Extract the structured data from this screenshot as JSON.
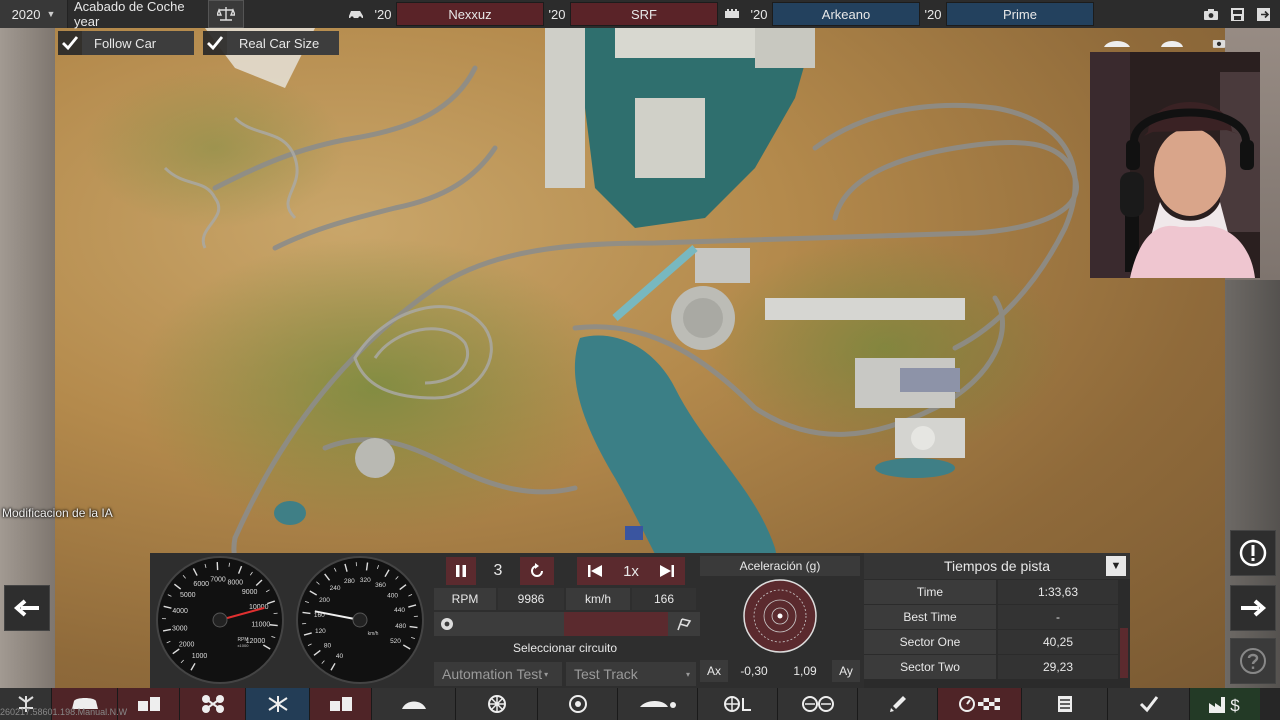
{
  "topbar": {
    "year": "2020",
    "finish_label": "Acabado de Coche year",
    "rival1_year": "'20",
    "rival1": "Nexxuz",
    "rival2_year": "'20",
    "rival2": "SRF",
    "rival3_year": "'20",
    "rival3": "Arkeano",
    "rival4_year": "'20",
    "rival4": "Prime"
  },
  "options": {
    "follow_car": "Follow Car",
    "real_car_size": "Real Car Size"
  },
  "ai_mod_label": "Modificacion de la IA",
  "gauges": {
    "rpm_ticks": [
      "1000",
      "2000",
      "3000",
      "4000",
      "5000",
      "6000",
      "7000",
      "8000",
      "9000",
      "10000",
      "11000",
      "12000"
    ],
    "rpm_unit": "RPM\nx1000",
    "speed_ticks": [
      "40",
      "80",
      "120",
      "160",
      "200",
      "240",
      "280",
      "320",
      "360",
      "400",
      "440",
      "480",
      "520"
    ],
    "speed_unit": "km/h"
  },
  "playback": {
    "lap": "3",
    "speed": "1x"
  },
  "readout": {
    "rpm_label": "RPM",
    "rpm_value": "9986",
    "speed_label": "km/h",
    "speed_value": "166",
    "select_circuit": "Seleccionar circuito",
    "track_group": "Automation Test",
    "track_name": "Test Track"
  },
  "accel": {
    "title": "Aceleración (g)",
    "ax_label": "Ax",
    "ax_value": "-0,30",
    "ay_value": "1,09",
    "ay_label": "Ay"
  },
  "lap_times": {
    "title": "Tiempos de pista",
    "rows": [
      {
        "label": "Time",
        "value": "1:33,63"
      },
      {
        "label": "Best Time",
        "value": "-"
      },
      {
        "label": "Sector One",
        "value": "40,25"
      },
      {
        "label": "Sector Two",
        "value": "29,23"
      }
    ]
  },
  "build_string": "260217.58601.198.Manual.N.W",
  "colors": {
    "accent_red": "#5b2a2e",
    "accent_blue": "#23415e",
    "check": "#ffffff"
  }
}
